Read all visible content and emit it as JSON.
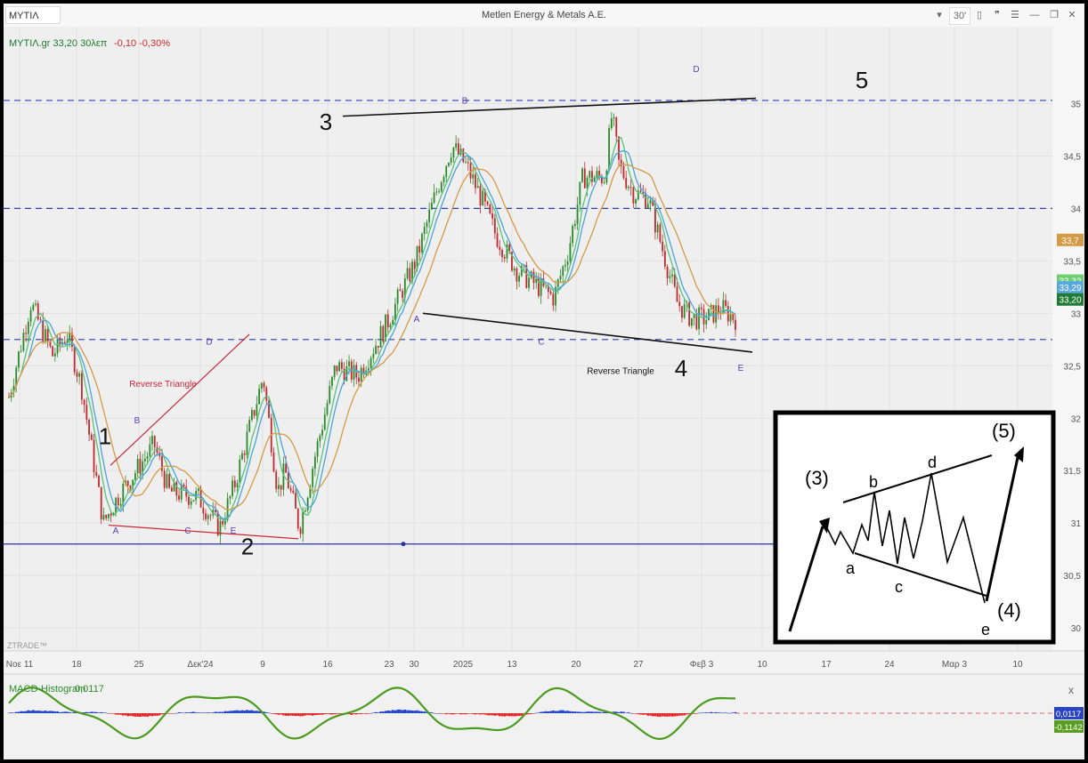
{
  "window": {
    "symbol": "MYTIΛ",
    "title": "Metlen Energy & Metals A.E.",
    "timeframe": "30'",
    "close_label": "x"
  },
  "quote": {
    "ticker": "MYTIΛ.gr 33,20 30λεπ",
    "change": "-0,10 -0,30%",
    "change_color": "#d62828"
  },
  "colors": {
    "candle_up": "#2a8a2a",
    "candle_down": "#c0282c",
    "ma_fast": "#57c27a",
    "ma_mid": "#4aa3d9",
    "ma_slow": "#d49a45",
    "hline_dashed": "#2a3fb0",
    "hline_solid": "#2733a6",
    "trendline_black": "#111111",
    "trendline_red": "#c9283a",
    "wave_letter": "#5b3fb3",
    "macd_up": "#1e3fc9",
    "macd_down": "#e02424",
    "macd_line": "#4b9b1e"
  },
  "watermark": "ZTRADE™",
  "macd": {
    "label": "MACD-Histogram",
    "value": "0,0117",
    "axis_badges": [
      {
        "text": "0,0117",
        "bg": "#2a44c4",
        "fg": "#ffffff"
      },
      {
        "text": "-0,1142",
        "bg": "#5a9e21",
        "fg": "#ffffff"
      }
    ]
  },
  "price_axis": {
    "min": 29.95,
    "max": 35.25,
    "ticks": [
      "35",
      "34,5",
      "34",
      "33,5",
      "33",
      "32,5",
      "32",
      "31,5",
      "31",
      "30,5",
      "30"
    ],
    "badges": [
      {
        "text": "33,7",
        "value": 33.7,
        "bg": "#d49a45",
        "fg": "#ffffff"
      },
      {
        "text": "33,32",
        "value": 33.32,
        "bg": "#6fcf6f",
        "fg": "#ffffff"
      },
      {
        "text": "33,29",
        "value": 33.29,
        "bg": "#5aa9de",
        "fg": "#ffffff"
      },
      {
        "text": "33,20",
        "value": 33.2,
        "bg": "#1f7a34",
        "fg": "#ffffff"
      }
    ]
  },
  "time_axis": {
    "labels": [
      "Noε 11",
      "18",
      "25",
      "Δεκ'24",
      "9",
      "16",
      "23",
      "30",
      "2025",
      "13",
      "20",
      "27",
      "Φεβ 3",
      "10",
      "17",
      "24",
      "Μαρ 3",
      "10"
    ]
  },
  "chart_data": {
    "type": "candlestick",
    "instrument": "MYTIΛ.gr",
    "interval": "30'",
    "last_close": 33.2,
    "ylim": [
      29.95,
      35.25
    ],
    "horizontal_lines": [
      {
        "value": 35.03,
        "style": "dashed"
      },
      {
        "value": 34.0,
        "style": "dashed"
      },
      {
        "value": 32.75,
        "style": "dashed"
      },
      {
        "value": 30.8,
        "style": "solid"
      }
    ],
    "price_path": [
      [
        0,
        32.2
      ],
      [
        0.03,
        33.1
      ],
      [
        0.06,
        32.6
      ],
      [
        0.08,
        32.8
      ],
      [
        0.1,
        32.3
      ],
      [
        0.13,
        31.0
      ],
      [
        0.15,
        31.25
      ],
      [
        0.2,
        31.75
      ],
      [
        0.22,
        31.3
      ],
      [
        0.26,
        31.25
      ],
      [
        0.29,
        30.95
      ],
      [
        0.31,
        31.35
      ],
      [
        0.35,
        32.4
      ],
      [
        0.37,
        31.3
      ],
      [
        0.38,
        31.5
      ],
      [
        0.4,
        30.95
      ],
      [
        0.42,
        31.6
      ],
      [
        0.45,
        32.5
      ],
      [
        0.48,
        32.4
      ],
      [
        0.52,
        32.9
      ],
      [
        0.56,
        33.5
      ],
      [
        0.59,
        34.2
      ],
      [
        0.61,
        34.6
      ],
      [
        0.63,
        34.4
      ],
      [
        0.65,
        34.1
      ],
      [
        0.67,
        33.75
      ],
      [
        0.7,
        33.4
      ],
      [
        0.73,
        33.25
      ],
      [
        0.75,
        33.15
      ],
      [
        0.77,
        33.6
      ],
      [
        0.79,
        34.3
      ],
      [
        0.82,
        34.3
      ],
      [
        0.83,
        34.9
      ],
      [
        0.84,
        34.4
      ],
      [
        0.86,
        34.15
      ],
      [
        0.88,
        34.1
      ],
      [
        0.9,
        33.6
      ],
      [
        0.92,
        33.1
      ],
      [
        0.94,
        32.95
      ],
      [
        0.96,
        32.95
      ],
      [
        0.98,
        33.05
      ],
      [
        1.0,
        32.95
      ]
    ],
    "trendlines": [
      {
        "color": "black",
        "from": {
          "date": "Jan 2",
          "value": 34.88
        },
        "to": {
          "date": "Feb 7",
          "value": 35.05
        }
      },
      {
        "color": "black",
        "from": {
          "date": "Jan 2",
          "value": 33.0
        },
        "to": {
          "date": "Feb 8",
          "value": 32.63
        }
      },
      {
        "color": "red",
        "from": {
          "date": "Nov 20",
          "value": 31.55
        },
        "to": {
          "date": "Dec 6",
          "value": 32.8
        }
      },
      {
        "color": "red",
        "from": {
          "date": "Nov 20",
          "value": 30.98
        },
        "to": {
          "date": "Dec 12",
          "value": 30.85
        }
      }
    ],
    "annotations": {
      "wave_numbers": [
        {
          "text": "1",
          "value": 31.75
        },
        {
          "text": "2",
          "value": 30.7
        },
        {
          "text": "3",
          "value": 34.75
        },
        {
          "text": "4",
          "value": 32.4
        },
        {
          "text": "5",
          "value": 35.15
        }
      ],
      "wave_letters": [
        {
          "text": "A",
          "value": 30.9
        },
        {
          "text": "B",
          "value": 31.95
        },
        {
          "text": "C",
          "value": 30.9
        },
        {
          "text": "D",
          "value": 32.7
        },
        {
          "text": "E",
          "value": 30.9
        },
        {
          "text": "A",
          "value": 32.92
        },
        {
          "text": "B",
          "value": 35.0
        },
        {
          "text": "C",
          "value": 32.7
        },
        {
          "text": "D",
          "value": 35.3
        },
        {
          "text": "E",
          "value": 32.45
        }
      ],
      "pattern_labels": [
        {
          "text": "Reverse Triangle",
          "color": "#c9283a"
        },
        {
          "text": "Reverse Triangle",
          "color": "#111111"
        }
      ]
    },
    "indicators": [
      "moving average (fast)",
      "moving average (mid)",
      "moving average (slow)"
    ]
  },
  "inset": {
    "labels": [
      "(3)",
      "b",
      "d",
      "(5)",
      "a",
      "c",
      "(4)",
      "e"
    ]
  }
}
